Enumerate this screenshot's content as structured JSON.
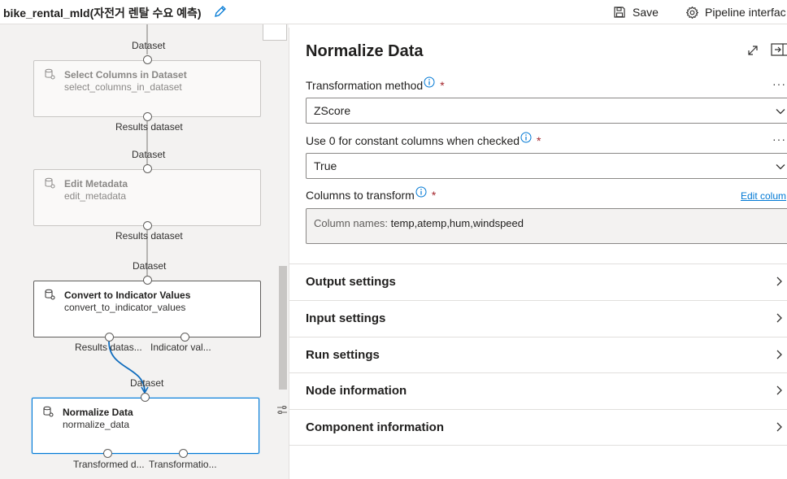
{
  "topbar": {
    "title": "bike_rental_mld(자전거 렌탈 수요 예측)",
    "save_label": "Save",
    "interface_label": "Pipeline interfac"
  },
  "canvas": {
    "labels": {
      "in1": "Dataset",
      "out1": "Results dataset",
      "in2": "Dataset",
      "out2": "Results dataset",
      "in3": "Dataset",
      "out3a": "Results datas...",
      "out3b": "Indicator val...",
      "in4": "Dataset",
      "out4a": "Transformed d...",
      "out4b": "Transformatio..."
    },
    "nodes": [
      {
        "title": "Select Columns in Dataset",
        "sub": "select_columns_in_dataset"
      },
      {
        "title": "Edit Metadata",
        "sub": "edit_metadata"
      },
      {
        "title": "Convert to Indicator Values",
        "sub": "convert_to_indicator_values"
      },
      {
        "title": "Normalize Data",
        "sub": "normalize_data"
      }
    ]
  },
  "panel": {
    "title": "Normalize Data",
    "transformation_label": "Transformation method",
    "transformation_value": "ZScore",
    "constant_label": "Use 0 for constant columns when checked",
    "constant_value": "True",
    "columns_label": "Columns to transform",
    "edit_columns_label": "Edit colum",
    "columns_prefix": "Column names:",
    "columns_value": "temp,atemp,hum,windspeed",
    "required_mark": "*",
    "more_glyph": "···",
    "sections": [
      "Output settings",
      "Input settings",
      "Run settings",
      "Node information",
      "Component information"
    ]
  },
  "colors": {
    "accent": "#0078d4",
    "selected_edge": "#0f6cbd",
    "required": "#a4262c"
  }
}
